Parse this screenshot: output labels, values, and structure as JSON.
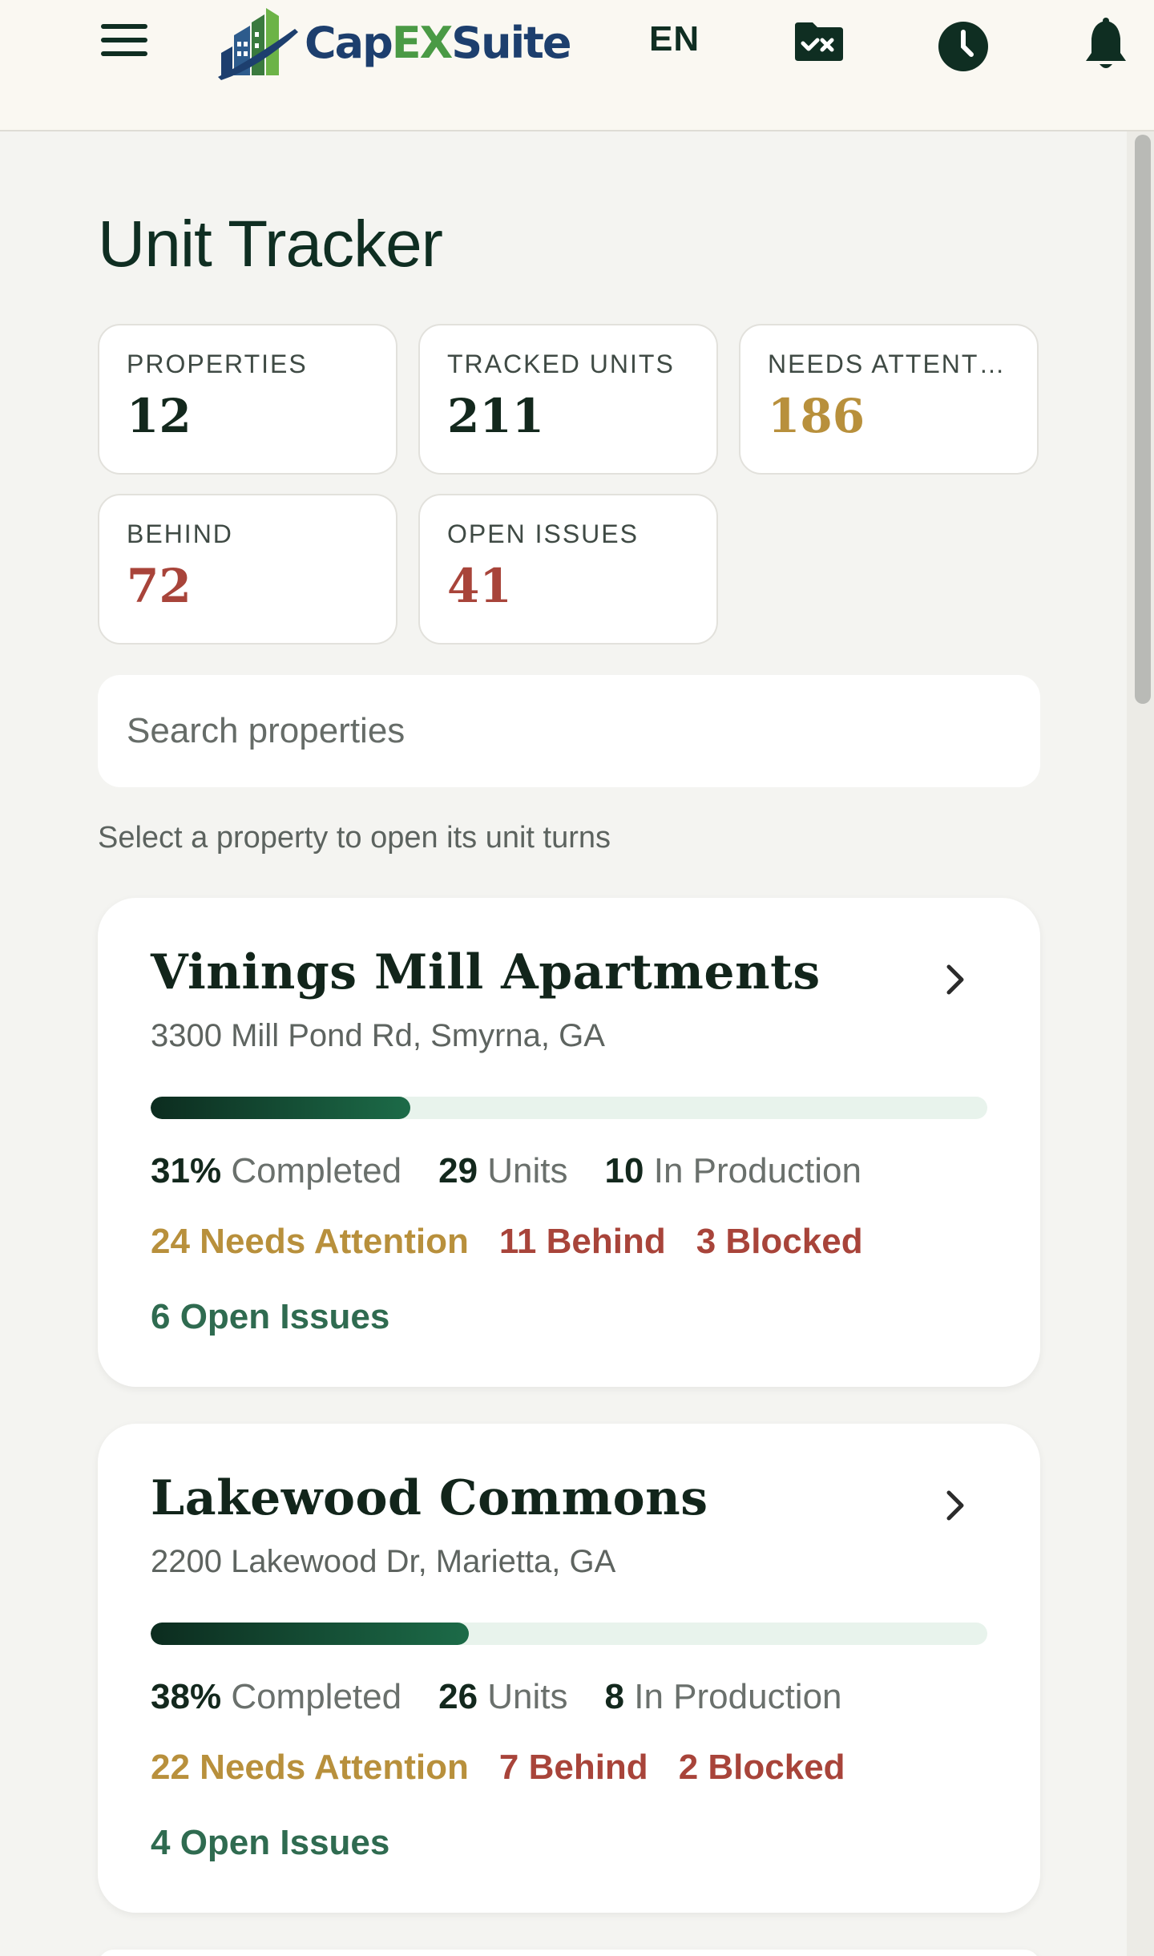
{
  "header": {
    "logo": {
      "cap": "Cap",
      "ex": "EX",
      "suite": "Suite"
    },
    "language": "EN",
    "icons": [
      "menu-icon",
      "folder-check-icon",
      "clock-icon",
      "bell-icon"
    ]
  },
  "page": {
    "title": "Unit Tracker"
  },
  "stats": [
    {
      "label": "PROPERTIES",
      "value": "12",
      "color": "#13281d"
    },
    {
      "label": "TRACKED UNITS",
      "value": "211",
      "color": "#13281d"
    },
    {
      "label": "NEEDS ATTENTI…",
      "value": "186",
      "color": "#b8903c"
    },
    {
      "label": "BEHIND",
      "value": "72",
      "color": "#a8443a"
    },
    {
      "label": "OPEN ISSUES",
      "value": "41",
      "color": "#a8443a"
    }
  ],
  "search": {
    "placeholder": "Search properties"
  },
  "hint": "Select a property to open its unit turns",
  "properties": [
    {
      "name": "Vinings Mill Apartments",
      "address": "3300 Mill Pond Rd, Smyrna, GA",
      "progress": 0.31,
      "completed_pct": "31%",
      "completed_label": "Completed",
      "units": "29",
      "units_label": "Units",
      "in_production": "10",
      "in_production_label": "In Production",
      "needs_attention": "24 Needs Attention",
      "behind": "11 Behind",
      "blocked": "3 Blocked",
      "open_issues": "6 Open Issues"
    },
    {
      "name": "Lakewood Commons",
      "address": "2200 Lakewood Dr, Marietta, GA",
      "progress": 0.38,
      "completed_pct": "38%",
      "completed_label": "Completed",
      "units": "26",
      "units_label": "Units",
      "in_production": "8",
      "in_production_label": "In Production",
      "needs_attention": "22 Needs Attention",
      "behind": "7 Behind",
      "blocked": "2 Blocked",
      "open_issues": "4 Open Issues"
    }
  ],
  "colors": {
    "primary": "#0f2e22",
    "gold": "#b8903c",
    "red": "#a8443a",
    "green": "#2f6b50"
  }
}
